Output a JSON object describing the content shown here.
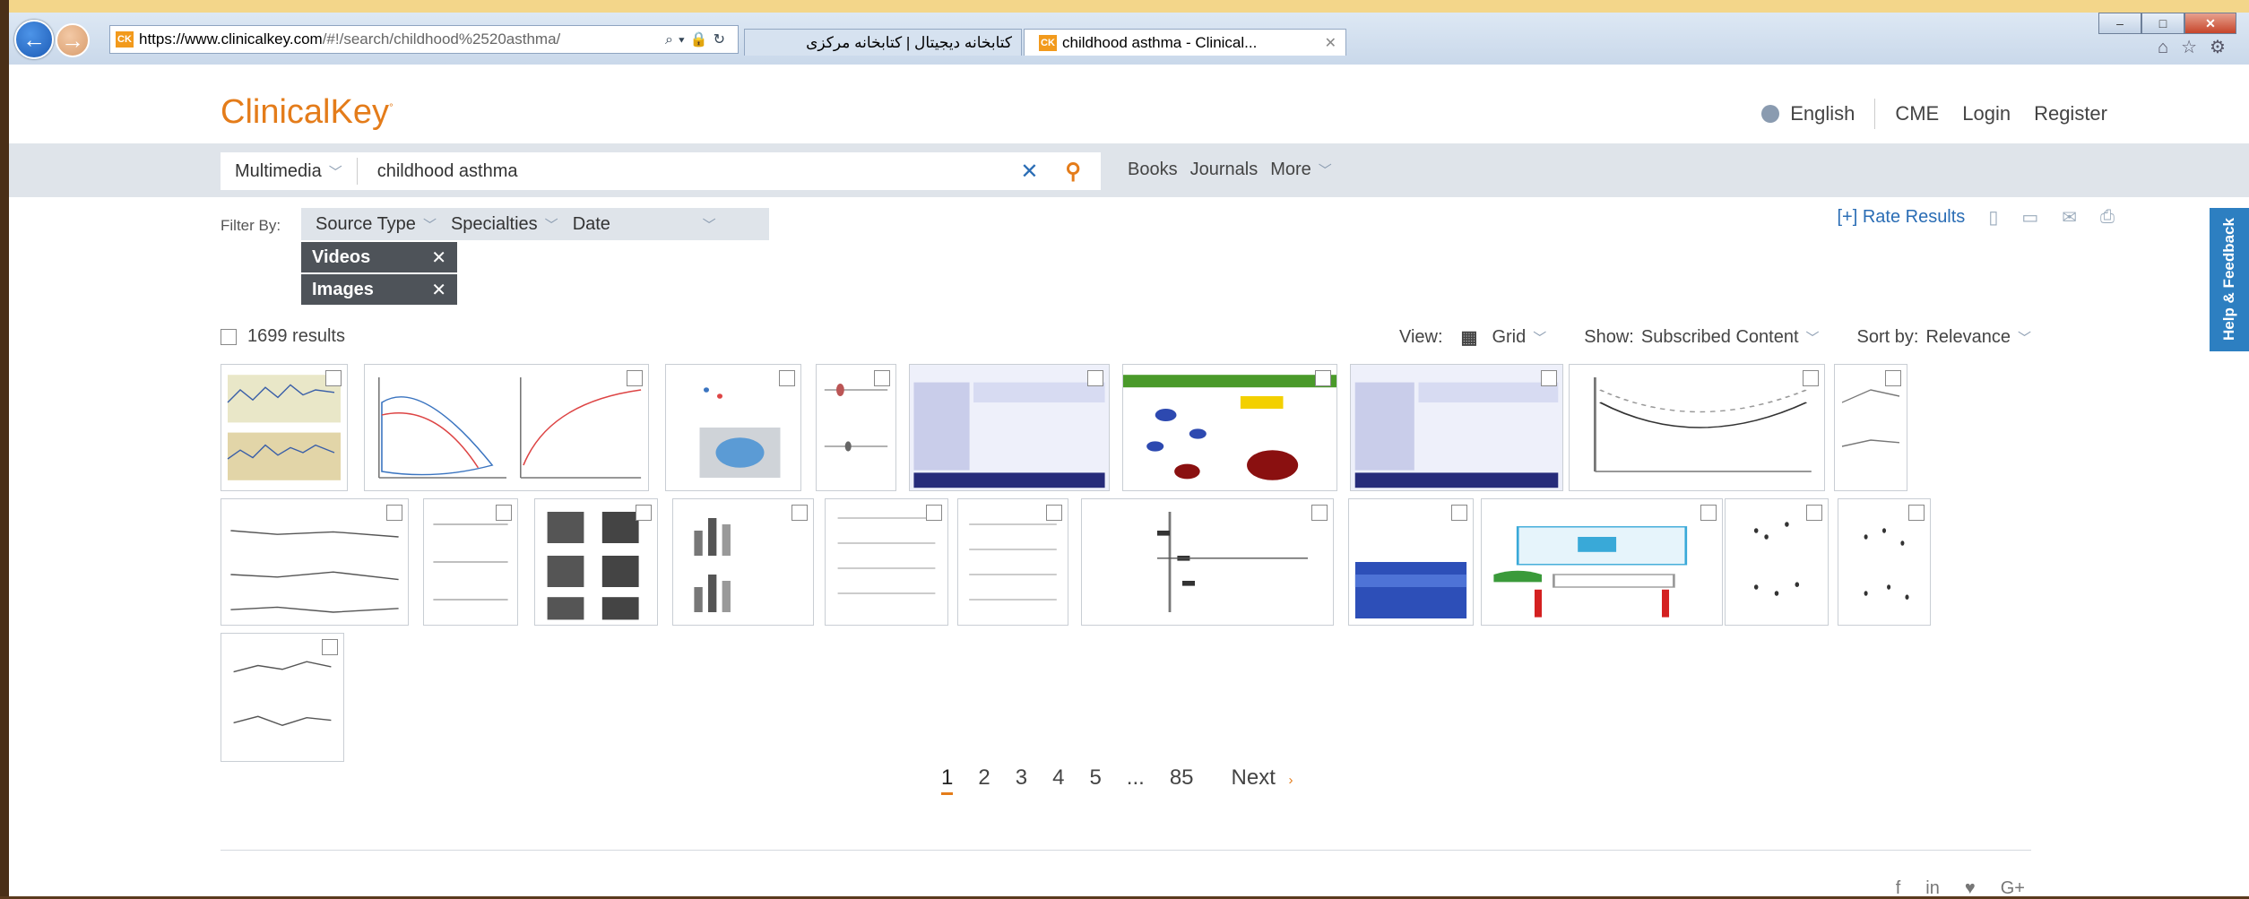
{
  "browser": {
    "url_host": "https://www.clinicalkey.com",
    "url_rest": "/#!/search/childhood%2520asthma/",
    "tabs": [
      {
        "label": "کتابخانه دیجیتال | کتابخانه مرکزی"
      },
      {
        "label": "childhood asthma - Clinical..."
      }
    ],
    "favicon_text": "CK"
  },
  "header": {
    "brand": "ClinicalKey",
    "language": "English",
    "links": [
      "CME",
      "Login",
      "Register"
    ]
  },
  "search": {
    "type": "Multimedia",
    "query": "childhood asthma",
    "links": [
      "Books",
      "Journals",
      "More"
    ]
  },
  "filters": {
    "label": "Filter By:",
    "items": [
      "Source Type",
      "Specialties",
      "Date"
    ],
    "chips": [
      "Videos",
      "Images"
    ]
  },
  "rate_results": "[+] Rate Results",
  "feedback": "Help & Feedback",
  "results": {
    "count": "1699 results",
    "view_label": "View:",
    "view_value": "Grid",
    "show_label": "Show:",
    "show_value": "Subscribed Content",
    "sort_label": "Sort by:",
    "sort_value": "Relevance"
  },
  "pagination": {
    "pages": [
      "1",
      "2",
      "3",
      "4",
      "5",
      "...",
      "85"
    ],
    "next": "Next"
  },
  "social": [
    "f",
    "in",
    "♥",
    "G+"
  ],
  "colors": {
    "brand": "#e47c1a",
    "link": "#2a6db5",
    "chip": "#4e5359"
  }
}
